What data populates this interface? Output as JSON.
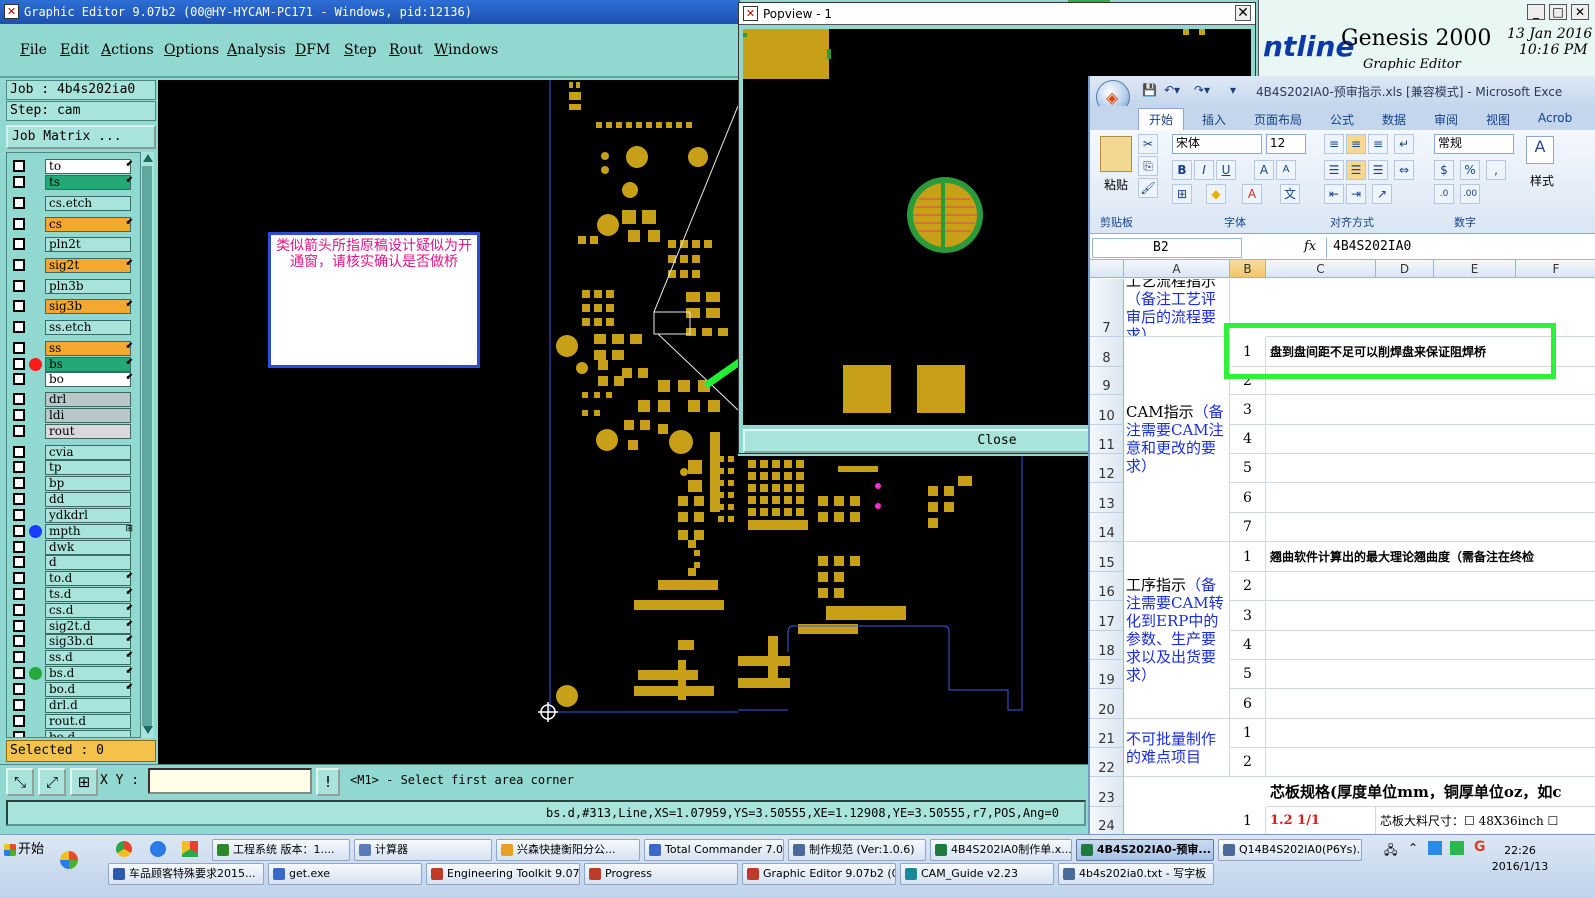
{
  "graphic_editor": {
    "title": "Graphic Editor 9.07b2 (00@HY-HYCAM-PC171 - Windows, pid:12136)",
    "menu": [
      "File",
      "Edit",
      "Actions",
      "Options",
      "Analysis",
      "DFM",
      "Step",
      "Rout",
      "Windows"
    ],
    "job_line": "Job : 4b4s202ia0",
    "step_line": "Step: cam",
    "job_matrix_label": "Job Matrix ...",
    "layers": [
      {
        "name": "to",
        "color": "#ffffff",
        "dot": "",
        "mark": "⬋"
      },
      {
        "name": "ts",
        "color": "#25a878",
        "dot": "",
        "mark": "⬋"
      },
      {
        "name": "cs.etch",
        "color": "#a8e4dc",
        "dot": "",
        "mark": ""
      },
      {
        "name": "cs",
        "color": "#f4a830",
        "dot": "",
        "mark": "⬋"
      },
      {
        "name": "pln2t",
        "color": "#a8e4dc",
        "dot": "",
        "mark": ""
      },
      {
        "name": "sig2t",
        "color": "#f4a830",
        "dot": "",
        "mark": "⬋"
      },
      {
        "name": "pln3b",
        "color": "#a8e4dc",
        "dot": "",
        "mark": ""
      },
      {
        "name": "sig3b",
        "color": "#f4a830",
        "dot": "",
        "mark": "⬋"
      },
      {
        "name": "ss.etch",
        "color": "#a8e4dc",
        "dot": "",
        "mark": ""
      },
      {
        "name": "ss",
        "color": "#f4a830",
        "dot": "",
        "mark": "⬋"
      },
      {
        "name": "bs",
        "color": "#25a878",
        "dot": "#ff1a1a",
        "mark": "⬋"
      },
      {
        "name": "bo",
        "color": "#ffffff",
        "dot": "",
        "mark": "⬋"
      },
      {
        "name": "drl",
        "color": "#b8c8c8",
        "dot": "",
        "mark": ""
      },
      {
        "name": "ldi",
        "color": "#b8c8c8",
        "dot": "",
        "mark": ""
      },
      {
        "name": "rout",
        "color": "#d8d8d8",
        "dot": "",
        "mark": ""
      },
      {
        "name": "cvia",
        "color": "#a8e4dc",
        "dot": "",
        "mark": ""
      },
      {
        "name": "tp",
        "color": "#a8e4dc",
        "dot": "",
        "mark": ""
      },
      {
        "name": "bp",
        "color": "#a8e4dc",
        "dot": "",
        "mark": ""
      },
      {
        "name": "dd",
        "color": "#a8e4dc",
        "dot": "",
        "mark": ""
      },
      {
        "name": "ydkdrl",
        "color": "#a8e4dc",
        "dot": "",
        "mark": ""
      },
      {
        "name": "mpth",
        "color": "#a8e4dc",
        "dot": "#1a3cff",
        "mark": "⊞"
      },
      {
        "name": "dwk",
        "color": "#a8e4dc",
        "dot": "",
        "mark": ""
      },
      {
        "name": "d",
        "color": "#a8e4dc",
        "dot": "",
        "mark": ""
      },
      {
        "name": "to.d",
        "color": "#a8e4dc",
        "dot": "",
        "mark": "⬋"
      },
      {
        "name": "ts.d",
        "color": "#a8e4dc",
        "dot": "",
        "mark": "⬋"
      },
      {
        "name": "cs.d",
        "color": "#a8e4dc",
        "dot": "",
        "mark": "⬋"
      },
      {
        "name": "sig2t.d",
        "color": "#a8e4dc",
        "dot": "",
        "mark": "⬋"
      },
      {
        "name": "sig3b.d",
        "color": "#a8e4dc",
        "dot": "",
        "mark": "⬋"
      },
      {
        "name": "ss.d",
        "color": "#a8e4dc",
        "dot": "",
        "mark": "⬋"
      },
      {
        "name": "bs.d",
        "color": "#a8e4dc",
        "dot": "#27a83c",
        "mark": "⬋"
      },
      {
        "name": "bo.d",
        "color": "#a8e4dc",
        "dot": "",
        "mark": "⬋"
      },
      {
        "name": "drl.d",
        "color": "#a8e4dc",
        "dot": "",
        "mark": ""
      },
      {
        "name": "rout.d",
        "color": "#a8e4dc",
        "dot": "",
        "mark": ""
      },
      {
        "name": "bo.d",
        "color": "#a8e4dc",
        "dot": "",
        "mark": ""
      }
    ],
    "selected_label": "Selected : 0",
    "xy_label": "X Y :",
    "xy_value": "",
    "prompt": "<M1> - Select first area corner",
    "status": "bs.d,#313,Line,XS=1.07959,YS=3.50555,XE=1.12908,YE=3.50555,r7,POS,Ang=0",
    "badge": "51"
  },
  "annotation": {
    "text": "类似箭头所指原稿设计疑似为开通窗，请核实确认是否做桥"
  },
  "popview": {
    "title": "Popview - 1",
    "close_label": "Close"
  },
  "genesis": {
    "brand": "ntline",
    "title": "Genesis 2000",
    "subtitle": "Graphic Editor",
    "date": "13 Jan 2016",
    "time": "10:16 PM"
  },
  "excel": {
    "title": "4B4S202IA0-预审指示.xls [兼容模式] - Microsoft Exce",
    "tabs": [
      "开始",
      "插入",
      "页面布局",
      "公式",
      "数据",
      "审阅",
      "视图",
      "Acrob"
    ],
    "font_name": "宋体",
    "font_size": "12",
    "number_format": "常规",
    "groups": [
      "剪贴板",
      "字体",
      "对齐方式",
      "数字"
    ],
    "paste_label": "粘贴",
    "styles_label": "样式",
    "name_box": "B2",
    "formula_value": "4B4S202IA0",
    "columns": [
      "A",
      "B",
      "C",
      "D",
      "E",
      "F"
    ],
    "row_numbers": [
      "7",
      "8",
      "9",
      "10",
      "11",
      "12",
      "13",
      "14",
      "15",
      "16",
      "17",
      "18",
      "19",
      "20",
      "21",
      "22",
      "23",
      "24"
    ],
    "section_a": [
      {
        "text": "工艺流程指示（备注工艺评审后的流程要求）",
        "prefix": "工艺流程指示",
        "rest": "（备注工艺评审后的流程要求）"
      },
      {
        "text": "CAM指示（备注需要CAM注意和更改的要求）",
        "prefix": "CAM指示",
        "rest": "（备注需要CAM注意和更改的要求）"
      },
      {
        "text": "工序指示（备注需要CAM转化到ERP中的参数、生产要求以及出货要求）",
        "prefix": "工序指示",
        "rest": "（备注需要CAM转化到ERP中的参数、生产要求以及出货要求）"
      },
      {
        "text": "不可批量制作的难点项目",
        "prefix": "不可批量制作的难点项目",
        "rest": ""
      }
    ],
    "b_values": [
      "1",
      "2",
      "3",
      "4",
      "5",
      "6",
      "7",
      "1",
      "2",
      "3",
      "4",
      "5",
      "6",
      "1",
      "2",
      "1"
    ],
    "row8_text": "盘到盘间距不足可以削焊盘来保证阻焊桥",
    "row15_text": "翘曲软件计算出的最大理论翘曲度（需备注在终检",
    "row23_text": "芯板规格(厚度单位mm，铜厚单位oz，如c",
    "row24_b": "1.2 1/1",
    "row24_d": "芯板大料尺寸：☐ 48X36inch ☐"
  },
  "taskbar": {
    "start_label": "开始",
    "row1": [
      {
        "label": "工程系统 版本：1....",
        "icon": "#2a8a2a"
      },
      {
        "label": "计算器",
        "icon": "#5a7ab8"
      },
      {
        "label": "兴森快捷衡阳分公...",
        "icon": "#e8a020"
      },
      {
        "label": "Total Commander 7.0...",
        "icon": "#3a6ac8"
      },
      {
        "label": "制作规范 (Ver:1.0.6)",
        "icon": "#4a6a9a"
      },
      {
        "label": "4B4S202IA0制作单.x...",
        "icon": "#1e7a3e"
      },
      {
        "label": "4B4S202IA0-预审...",
        "icon": "#1e7a3e"
      },
      {
        "label": "Q14B4S202IA0(P6Ys)...",
        "icon": "#4a6a9a"
      }
    ],
    "row2": [
      {
        "label": "车品顾客特殊要求2015...",
        "icon": "#2a5aa8"
      },
      {
        "label": "get.exe",
        "icon": "#3a6ac8"
      },
      {
        "label": "Engineering Toolkit 9.07...",
        "icon": "#c03a2a"
      },
      {
        "label": "Progress",
        "icon": "#c03a2a"
      },
      {
        "label": "Graphic Editor 9.07b2 (0...",
        "icon": "#c03a2a"
      },
      {
        "label": "CAM_Guide v2.23",
        "icon": "#1a8a9a"
      },
      {
        "label": "4b4s202ia0.txt - 写字板",
        "icon": "#4a6a9a"
      }
    ],
    "clock_time": "22:26",
    "clock_date": "2016/1/13"
  }
}
